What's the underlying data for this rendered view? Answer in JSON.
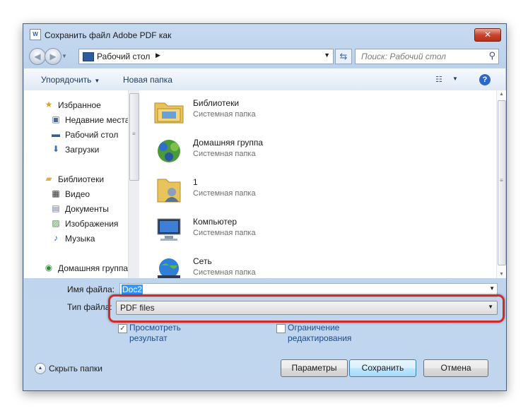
{
  "window": {
    "title": "Сохранить файл Adobe PDF как",
    "app_icon": "W"
  },
  "address": {
    "location": "Рабочий стол"
  },
  "search": {
    "placeholder": "Поиск: Рабочий стол"
  },
  "toolbar": {
    "organize": "Упорядочить",
    "new_folder": "Новая папка"
  },
  "sidebar": {
    "items": [
      {
        "label": "Избранное",
        "icon": "star-icon",
        "glyph": "★",
        "color": "#d9a520"
      },
      {
        "label": "Недавние места",
        "icon": "recent-places-icon",
        "glyph": "▣",
        "color": "#4b6a8e"
      },
      {
        "label": "Рабочий стол",
        "icon": "desktop-icon",
        "glyph": "▬",
        "color": "#2f5e9e"
      },
      {
        "label": "Загрузки",
        "icon": "downloads-icon",
        "glyph": "⬇",
        "color": "#3d6fb8"
      },
      {
        "label": "Библиотеки",
        "icon": "libraries-icon",
        "glyph": "▰",
        "color": "#d9b24a"
      },
      {
        "label": "Видео",
        "icon": "video-icon",
        "glyph": "▦",
        "color": "#333333"
      },
      {
        "label": "Документы",
        "icon": "documents-icon",
        "glyph": "▤",
        "color": "#6a7a90"
      },
      {
        "label": "Изображения",
        "icon": "pictures-icon",
        "glyph": "▨",
        "color": "#4f8a4a"
      },
      {
        "label": "Музыка",
        "icon": "music-icon",
        "glyph": "♪",
        "color": "#2d68c4"
      },
      {
        "label": "Домашняя группа",
        "icon": "homegroup-icon",
        "glyph": "◉",
        "color": "#3a8a3a"
      }
    ]
  },
  "files": [
    {
      "name": "Библиотеки",
      "type": "Системная папка",
      "icon": "libraries-folder-icon"
    },
    {
      "name": "Домашняя группа",
      "type": "Системная папка",
      "icon": "homegroup-icon"
    },
    {
      "name": "1",
      "type": "Системная папка",
      "icon": "user-folder-icon"
    },
    {
      "name": "Компьютер",
      "type": "Системная папка",
      "icon": "computer-icon"
    },
    {
      "name": "Сеть",
      "type": "Системная папка",
      "icon": "network-icon"
    }
  ],
  "form": {
    "filename_label": "Имя файла:",
    "filename_value": "Doc2",
    "filetype_label": "Тип файла:",
    "filetype_value": "PDF files",
    "view_result_label_1": "Просмотреть",
    "view_result_label_2": "результат",
    "view_result_checked": true,
    "restrict_label_1": "Ограничение",
    "restrict_label_2": "редактирования",
    "restrict_checked": false
  },
  "footer": {
    "hide_folders": "Скрыть папки",
    "params_button": "Параметры",
    "save_button": "Сохранить",
    "cancel_button": "Отмена"
  },
  "highlight_color": "#d22b2b"
}
